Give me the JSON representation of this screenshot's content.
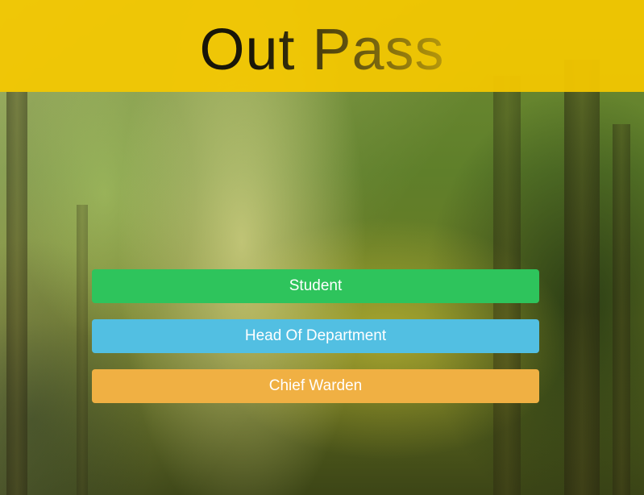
{
  "header": {
    "title": "Out Pass"
  },
  "roles": {
    "student_label": "Student",
    "hod_label": "Head Of Department",
    "warden_label": "Chief Warden"
  },
  "colors": {
    "header_background": "#f5c800",
    "student_button": "#2ec45c",
    "hod_button": "#52bfe2",
    "warden_button": "#f0b043",
    "button_text": "#ffffff"
  },
  "background": {
    "description_icon": "forest-sunlight-image"
  }
}
